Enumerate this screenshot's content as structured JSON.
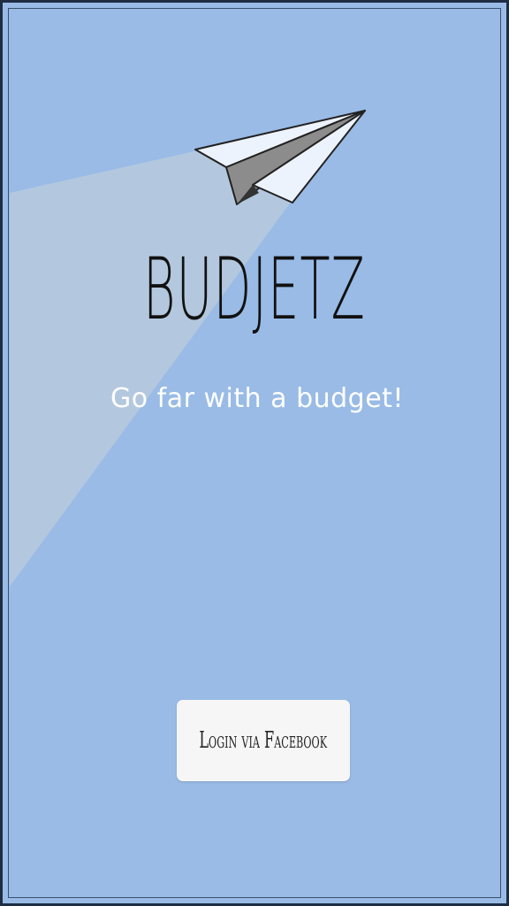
{
  "app": {
    "title": "BUDJETZ",
    "tagline": "Go far with a budget!"
  },
  "login": {
    "label": "Login via Facebook"
  },
  "colors": {
    "background": "#99bbe6",
    "trail": "#b3c8de",
    "plane_light": "#edf3fc",
    "plane_dark": "#8c8c8c",
    "button": "#f6f6f6"
  },
  "icons": {
    "plane": "paper-plane-icon"
  }
}
